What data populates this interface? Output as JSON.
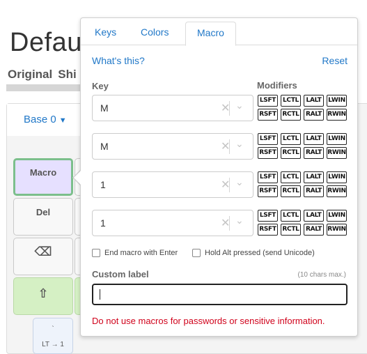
{
  "background": {
    "title": "Defaul",
    "tabs": [
      "Original",
      "Shi"
    ],
    "layer_selector": {
      "label": "Base 0",
      "icon": "caret-down-icon"
    },
    "keys": [
      {
        "label": "Macro",
        "state": "selected"
      },
      {
        "label": "Del"
      },
      {
        "label": "⌫"
      },
      {
        "label": "⇧"
      }
    ],
    "small_key": {
      "top": "`",
      "bottom": "LT → 1"
    }
  },
  "popover": {
    "tabs": [
      {
        "label": "Keys",
        "active": false
      },
      {
        "label": "Colors",
        "active": false
      },
      {
        "label": "Macro",
        "active": true
      }
    ],
    "whats_this": "What's this?",
    "reset": "Reset",
    "key_label": "Key",
    "modifiers_label": "Modifiers",
    "rows": [
      {
        "key": "M",
        "modifiers": [
          "LSFT",
          "LCTL",
          "LALT",
          "LWIN",
          "RSFT",
          "RCTL",
          "RALT",
          "RWIN"
        ]
      },
      {
        "key": "M",
        "modifiers": [
          "LSFT",
          "LCTL",
          "LALT",
          "LWIN",
          "RSFT",
          "RCTL",
          "RALT",
          "RWIN"
        ]
      },
      {
        "key": "1",
        "modifiers": [
          "LSFT",
          "LCTL",
          "LALT",
          "LWIN",
          "RSFT",
          "RCTL",
          "RALT",
          "RWIN"
        ]
      },
      {
        "key": "1",
        "modifiers": [
          "LSFT",
          "LCTL",
          "LALT",
          "LWIN",
          "RSFT",
          "RCTL",
          "RALT",
          "RWIN"
        ]
      }
    ],
    "clear_icon": "✕",
    "dropdown_icon": "⌄",
    "end_with_enter": {
      "label": "End macro with Enter",
      "checked": false
    },
    "hold_alt": {
      "label": "Hold Alt pressed (send Unicode)",
      "checked": false
    },
    "custom_label": {
      "label": "Custom label",
      "hint": "(10 chars max.)",
      "value": ""
    },
    "warning": "Do not use macros for passwords or sensitive information.",
    "warning_color": "#d0021b",
    "link_color": "#2178c8"
  }
}
